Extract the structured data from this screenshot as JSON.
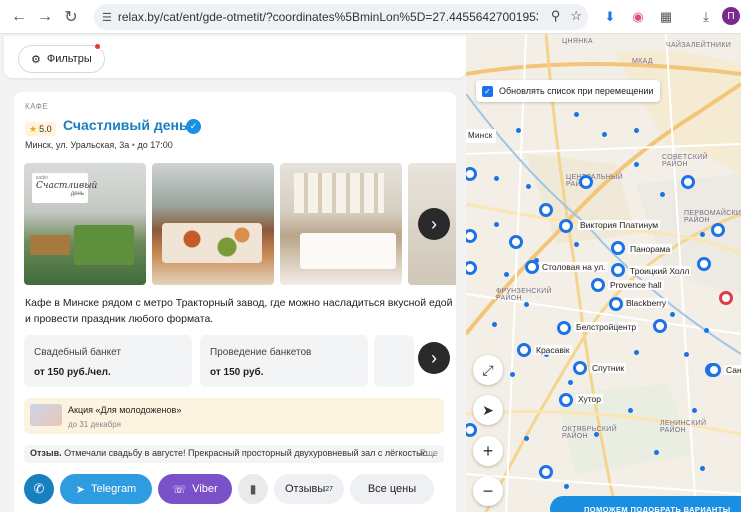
{
  "browser": {
    "url": "relax.by/cat/ent/gde-otmetit/?coordinates%5BminLon%5D=27.445564270019535&coo...",
    "profile_initial": "П"
  },
  "filters": {
    "label": "Фильтры"
  },
  "card": {
    "category": "КАФЕ",
    "rating": "5.0",
    "name": "Счастливый день",
    "address": "Минск, ул. Уральская, 3а",
    "hours": "до 17:00",
    "logo_line1": "Счастливый",
    "logo_line2": "день",
    "logo_top": "кафе",
    "description": "Кафе в Минске рядом с метро Тракторный завод, где можно насладиться вкусной едой и провести праздник любого формата.",
    "services": [
      {
        "name": "Свадебный банкет",
        "price": "от 150 руб./чел."
      },
      {
        "name": "Проведение банкетов",
        "price": "от 150 руб."
      }
    ],
    "promo": {
      "title": "Акция «Для молодоженов»",
      "date": "до 31 декабря"
    },
    "review": {
      "label": "Отзыв.",
      "text": " Отмечали свадьбу в августе! Прекрасный просторный двухуровневый зал с лёгкостью...",
      "more": "Еще"
    },
    "actions": {
      "telegram": "Telegram",
      "viber": "Viber",
      "reviews": "Отзывы",
      "reviews_count": "27",
      "prices": "Все цены"
    }
  },
  "map": {
    "update_label": "Обновлять список при перемещении",
    "help_label": "ПОМОЖЕМ ПОДОБРАТЬ ВАРИАНТЫ",
    "districts": [
      "ЦНЯНКА",
      "ЧАЙЗАЛЕЙТНИКИ",
      "МКАД",
      "ЦЕНТРАЛЬНЫЙ РАЙОН",
      "СОВЕТСКИЙ РАЙОН",
      "ПЕРВОМАЙСКИЙ РАЙОН",
      "ФРУНЗЕНСКИЙ РАЙОН",
      "ОКТЯБРЬСКИЙ РАЙОН",
      "ЛЕНИНСКИЙ РАЙОН",
      "Минск"
    ],
    "venues": [
      "Виктория Платинум",
      "Панорама",
      "Столовая на ул.",
      "Троицкий Холл",
      "Provence hall",
      "Blackberry",
      "Белстройцентр",
      "Красавік",
      "Спутник",
      "Хутор",
      "Сан"
    ],
    "accent": "#1a73e8",
    "highlight": "#e0394a"
  }
}
